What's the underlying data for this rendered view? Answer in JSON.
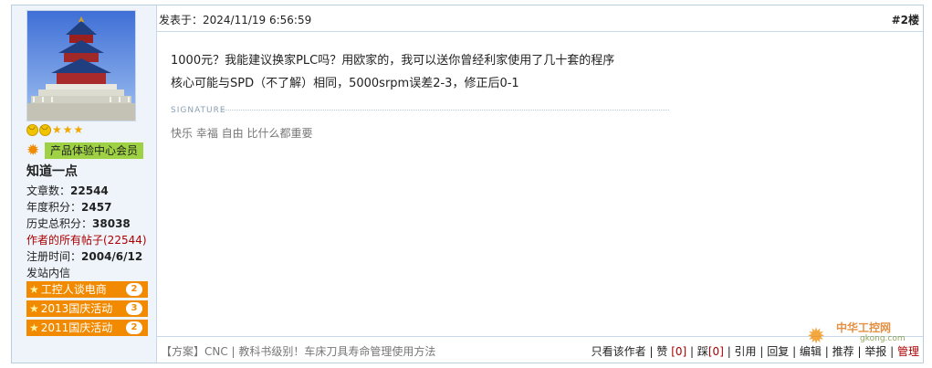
{
  "post": {
    "time_label": "发表于：2024/11/19 6:56:59",
    "floor": "#2楼",
    "lines": [
      "1000元？我能建议换家PLC吗？用欧家的，我可以送你曾经利家使用了几十套的程序",
      "核心可能与SPD（不了解）相同，5000srpm误差2-3，修正后0-1"
    ],
    "signature_label": "SIGNATURE",
    "signature_text": "快乐 幸福 自由 比什么都重要"
  },
  "author": {
    "group": "产品体验中心会员",
    "name": "知道一点",
    "stats": {
      "posts_label": "文章数：",
      "posts": "22544",
      "year_label": "年度积分：",
      "year": "2457",
      "total_label": "历史总积分：",
      "total": "38038",
      "all_posts": "作者的所有帖子(22544)",
      "reg_label": "注册时间：",
      "reg": "2004/6/12",
      "message": "发站内信"
    },
    "medals": [
      {
        "label": "工控人谈电商",
        "count": "2"
      },
      {
        "label": "2013国庆活动",
        "count": "3"
      },
      {
        "label": "2011国庆活动",
        "count": "2"
      }
    ]
  },
  "footer": {
    "related": "【方案】CNC | 教科书级别！车床刀具寿命管理使用方法",
    "only_author": "只看该作者",
    "sep": " | ",
    "like": "赞",
    "like_count": "[0]",
    "dislike": "踩",
    "dislike_count": "[0]",
    "quote": "引用",
    "reply": "回复",
    "edit": "编辑",
    "recommend": "推荐",
    "report": "举报",
    "manage": "管理"
  },
  "watermark": {
    "title": "中华工控网",
    "domain": "gkong.com"
  }
}
